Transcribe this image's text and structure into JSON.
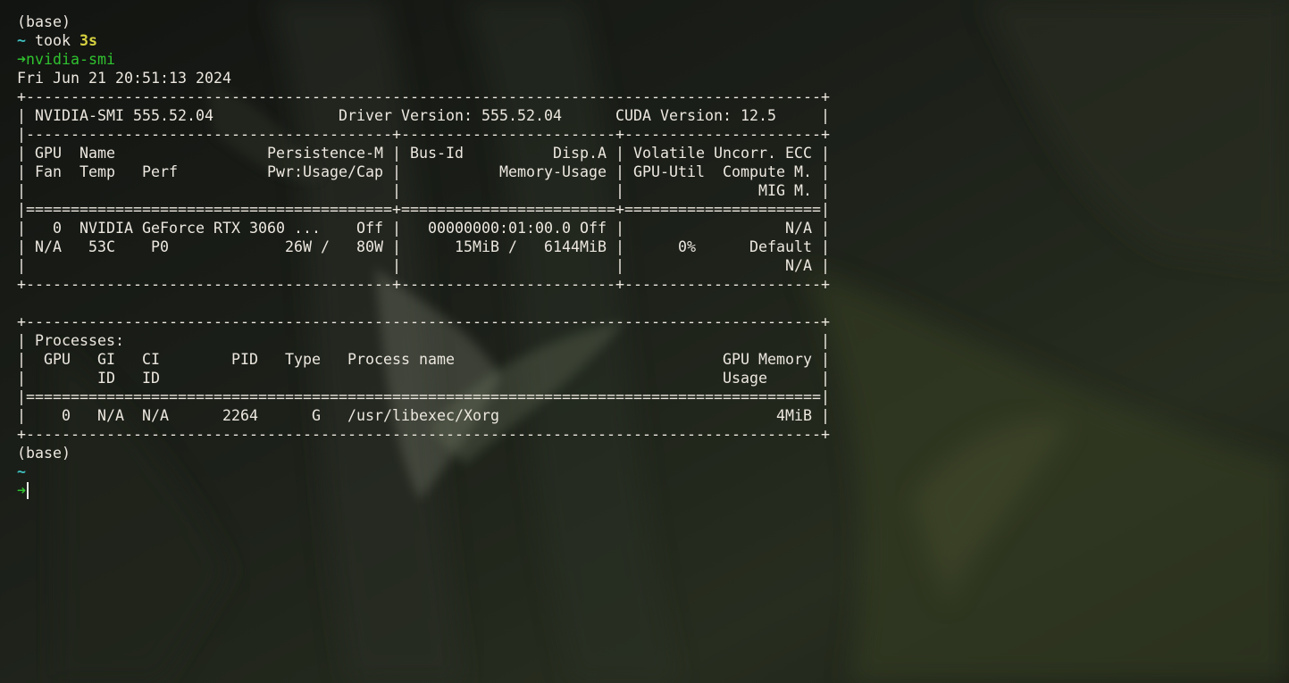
{
  "colors": {
    "background": "#1a1d18",
    "text": "#ece7df",
    "tilde": "#3ec0bf",
    "duration": "#d7d240",
    "prompt_arrow": "#2fc22f",
    "command": "#2fc22f"
  },
  "icons": {
    "prompt_arrow": "arrow-right-icon",
    "cursor": "text-cursor"
  },
  "session": {
    "env_label": "(base)",
    "cwd": "~",
    "took_label": " took ",
    "took_value": "3s",
    "arrow_glyph": "➜",
    "command": "nvidia-smi"
  },
  "output": {
    "lines": [
      "Fri Jun 21 20:51:13 2024",
      "+-----------------------------------------------------------------------------------------+",
      "| NVIDIA-SMI 555.52.04              Driver Version: 555.52.04      CUDA Version: 12.5     |",
      "|-----------------------------------------+------------------------+----------------------+",
      "| GPU  Name                 Persistence-M | Bus-Id          Disp.A | Volatile Uncorr. ECC |",
      "| Fan  Temp   Perf          Pwr:Usage/Cap |           Memory-Usage | GPU-Util  Compute M. |",
      "|                                         |                        |               MIG M. |",
      "|=========================================+========================+======================|",
      "|   0  NVIDIA GeForce RTX 3060 ...    Off |   00000000:01:00.0 Off |                  N/A |",
      "| N/A   53C    P0             26W /   80W |      15MiB /   6144MiB |      0%      Default |",
      "|                                         |                        |                  N/A |",
      "+-----------------------------------------+------------------------+----------------------+",
      "",
      "+-----------------------------------------------------------------------------------------+",
      "| Processes:                                                                              |",
      "|  GPU   GI   CI        PID   Type   Process name                              GPU Memory |",
      "|        ID   ID                                                               Usage      |",
      "|=========================================================================================|",
      "|    0   N/A  N/A      2264      G   /usr/libexec/Xorg                               4MiB |",
      "+-----------------------------------------------------------------------------------------+"
    ]
  },
  "next_prompt": {
    "env_label": "(base)",
    "cwd": "~",
    "arrow_glyph": "➜"
  }
}
